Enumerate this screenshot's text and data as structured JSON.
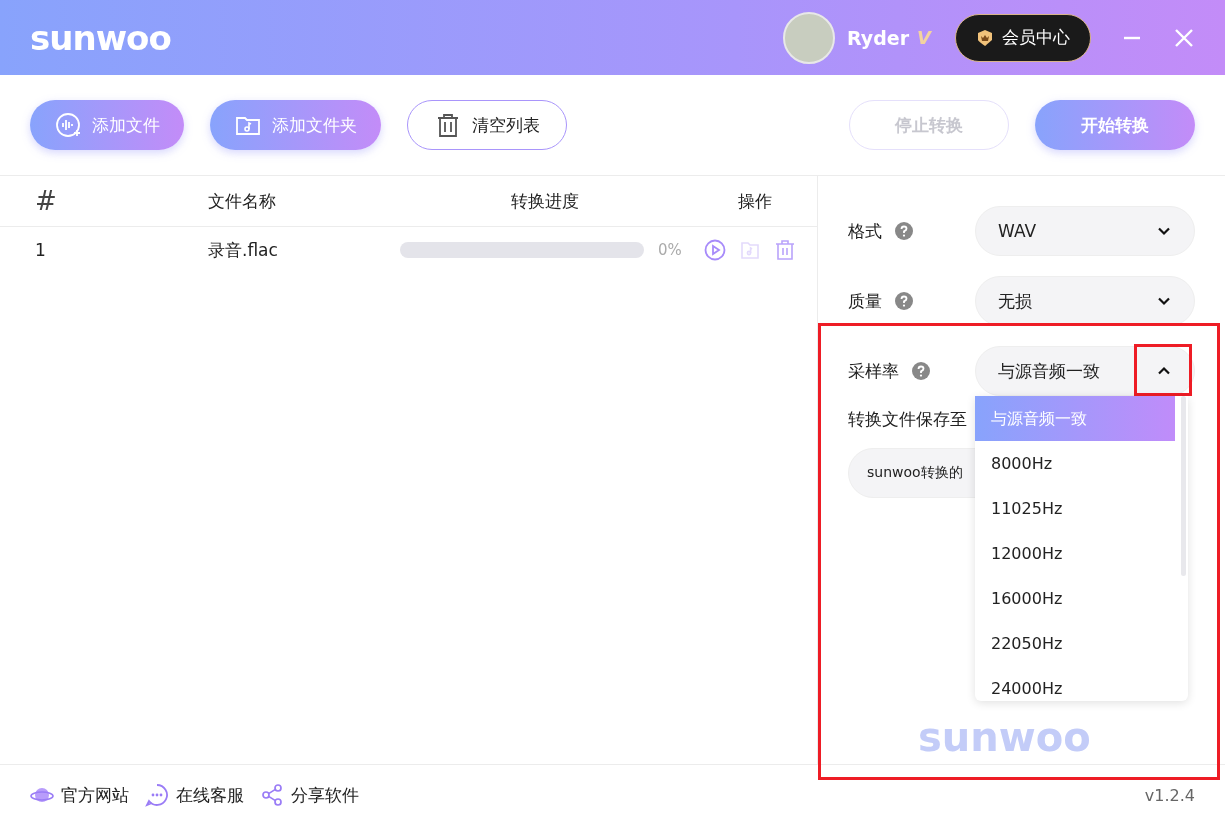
{
  "titlebar": {
    "logo": "sunwoo",
    "user": {
      "name": "Ryder",
      "vip_mark": "V"
    },
    "member_button": "会员中心"
  },
  "toolbar": {
    "left": [
      {
        "label": "添加文件",
        "kind": "audio"
      },
      {
        "label": "添加文件夹",
        "kind": "folder"
      },
      {
        "label": "清空列表",
        "kind": "trash"
      }
    ],
    "stop": {
      "label": "停止转换",
      "disabled": true
    },
    "start": {
      "label": "开始转换",
      "disabled": false
    }
  },
  "table": {
    "columns": [
      "#",
      "文件名称",
      "转换进度",
      "操作"
    ],
    "rows": [
      {
        "index": "1",
        "name": "录音.flac",
        "level": 0,
        "progress": "0%",
        "folder_disabled": true
      }
    ]
  },
  "settings": {
    "fields": [
      {
        "label": "格式",
        "value": "WAV",
        "expanded": false
      },
      {
        "label": "质量",
        "value": "无损",
        "expanded": false
      },
      {
        "label": "采样率",
        "value": "与源音频一致",
        "expanded": true
      }
    ],
    "save_label": "转换文件保存至",
    "save_path": "sunwoo转换的",
    "options": [
      {
        "label": "与源音频一致",
        "selected": true
      },
      {
        "label": "8000Hz",
        "selected": false
      },
      {
        "label": "11025Hz",
        "selected": false
      },
      {
        "label": "12000Hz",
        "selected": false
      },
      {
        "label": "16000Hz",
        "selected": false
      },
      {
        "label": "22050Hz",
        "selected": false
      },
      {
        "label": "24000Hz",
        "selected": false
      }
    ],
    "logo": "sunwoo"
  },
  "footer": {
    "links": [
      {
        "label": "官方网站",
        "kind": "planet"
      },
      {
        "label": "在线客服",
        "kind": "chat"
      },
      {
        "label": "分享软件",
        "kind": "share"
      }
    ],
    "version": "v1.2.4"
  }
}
